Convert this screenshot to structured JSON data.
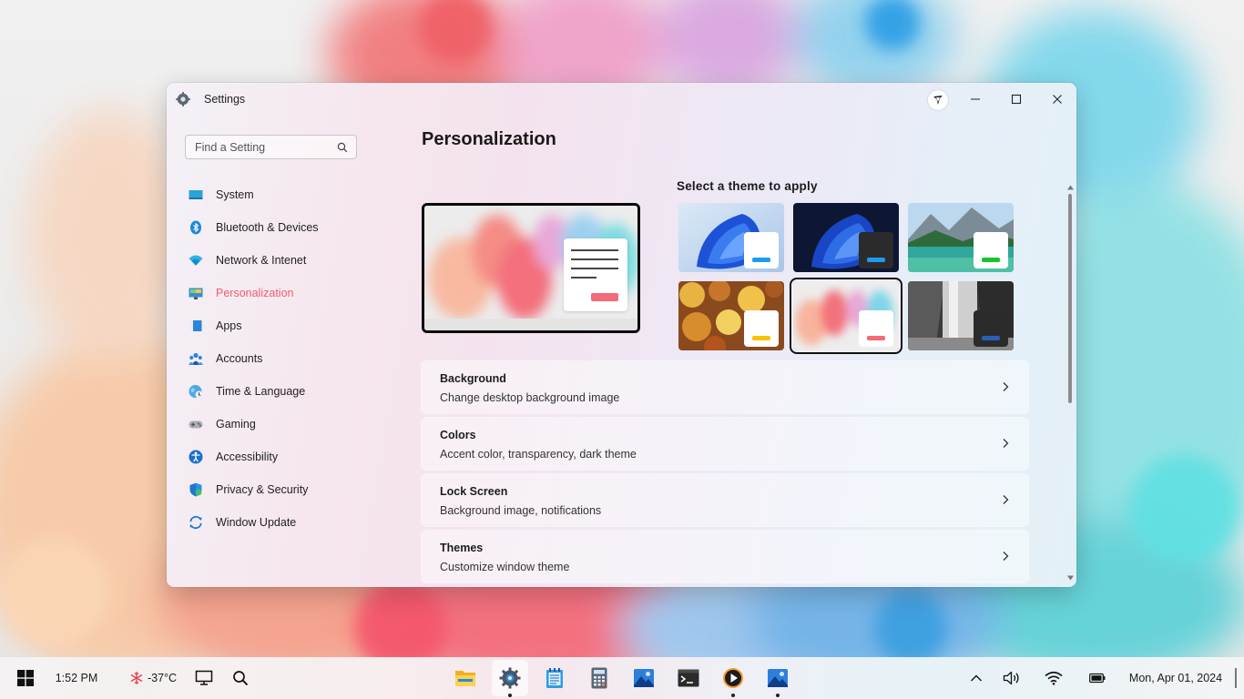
{
  "window": {
    "title": "Settings",
    "icon": "gear-icon"
  },
  "search": {
    "placeholder": "Find a Setting"
  },
  "sidebar": {
    "items": [
      {
        "label": "System",
        "icon": "monitor-icon",
        "active": false
      },
      {
        "label": "Bluetooth & Devices",
        "icon": "bluetooth-icon",
        "active": false
      },
      {
        "label": "Network & Intenet",
        "icon": "wifi-icon",
        "active": false
      },
      {
        "label": "Personalization",
        "icon": "paint-monitor-icon",
        "active": true
      },
      {
        "label": "Apps",
        "icon": "apps-icon",
        "active": false
      },
      {
        "label": "Accounts",
        "icon": "accounts-icon",
        "active": false
      },
      {
        "label": "Time & Language",
        "icon": "globe-clock-icon",
        "active": false
      },
      {
        "label": "Gaming",
        "icon": "gamepad-icon",
        "active": false
      },
      {
        "label": "Accessibility",
        "icon": "accessibility-icon",
        "active": false
      },
      {
        "label": "Privacy & Security",
        "icon": "shield-icon",
        "active": false
      },
      {
        "label": "Window Update",
        "icon": "update-icon",
        "active": false
      }
    ]
  },
  "main": {
    "title": "Personalization",
    "themes_heading": "Select a theme to apply",
    "themes": [
      {
        "name": "light-bloom",
        "accent": "#1e9bea",
        "mini_bg": "#ffffff",
        "selected": false
      },
      {
        "name": "dark-bloom",
        "accent": "#1e9bea",
        "mini_bg": "#2b2b2b",
        "selected": false
      },
      {
        "name": "lake",
        "accent": "#16c42e",
        "mini_bg": "#ffffff",
        "selected": false
      },
      {
        "name": "autumn",
        "accent": "#f5c400",
        "mini_bg": "#ffffff",
        "selected": false
      },
      {
        "name": "ink",
        "accent": "#f46a76",
        "mini_bg": "#ffffff",
        "selected": true
      },
      {
        "name": "waterfall",
        "accent": "#2a5fb5",
        "mini_bg": "#2b2b2b",
        "selected": false
      }
    ],
    "cards": [
      {
        "title": "Background",
        "subtitle": "Change desktop background image"
      },
      {
        "title": "Colors",
        "subtitle": "Accent color, transparency, dark theme"
      },
      {
        "title": "Lock Screen",
        "subtitle": "Background image, notifications"
      },
      {
        "title": "Themes",
        "subtitle": "Customize window theme"
      }
    ]
  },
  "taskbar": {
    "time": "1:52 PM",
    "weather": "-37°C",
    "date": "Mon, Apr 01, 2024",
    "apps": [
      {
        "name": "file-explorer-icon",
        "active": false,
        "running": false
      },
      {
        "name": "settings-icon",
        "active": true,
        "running": true
      },
      {
        "name": "notepad-icon",
        "active": false,
        "running": false
      },
      {
        "name": "calculator-icon",
        "active": false,
        "running": false
      },
      {
        "name": "photos-icon",
        "active": false,
        "running": false
      },
      {
        "name": "terminal-icon",
        "active": false,
        "running": false
      },
      {
        "name": "media-player-icon",
        "active": false,
        "running": true
      },
      {
        "name": "photos-icon",
        "active": false,
        "running": true
      }
    ]
  }
}
